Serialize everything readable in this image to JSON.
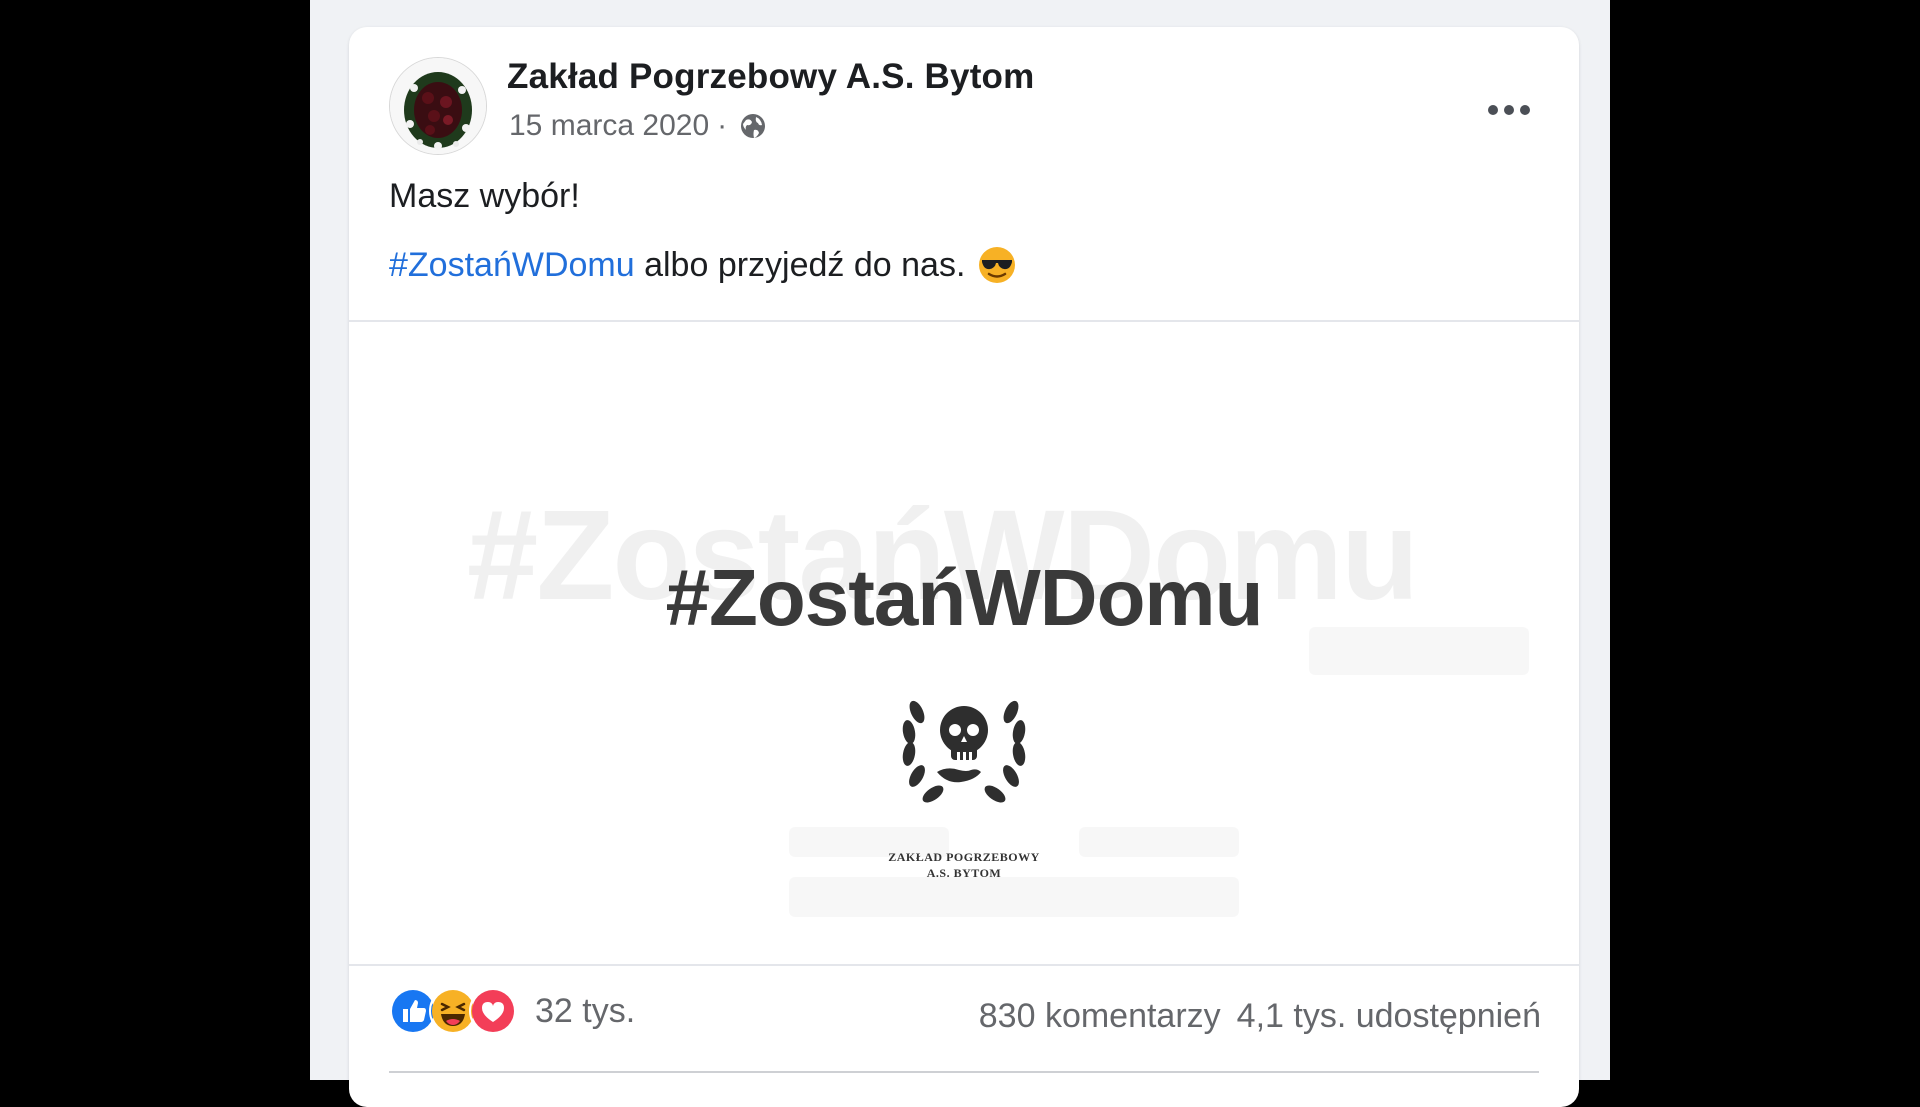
{
  "post": {
    "author": "Zakład Pogrzebowy A.S. Bytom",
    "date": "15 marca 2020",
    "separator": "·",
    "privacy_icon": "globe-icon",
    "more_icon": "more-options-icon",
    "text_line1": "Masz wybór!",
    "hashtag": "#ZostańWDomu",
    "text_line2_rest": " albo przyjedź do nas.",
    "emoji": "sunglasses-emoji"
  },
  "image": {
    "main_text": "#ZostańWDomu",
    "ghost_text": "#ZostańWDomu",
    "logo_line1": "ZAKŁAD POGRZEBOWY",
    "logo_line2": "A.S. BYTOM"
  },
  "footer": {
    "reactions": [
      "like-icon",
      "haha-icon",
      "love-icon"
    ],
    "reaction_count": "32 tys.",
    "comments": "830 komentarzy",
    "shares": "4,1 tys. udostępnień"
  },
  "colors": {
    "link": "#216fdb",
    "like": "#1877f2",
    "love": "#f33e58",
    "haha": "#f7b125",
    "text": "#1c1e21",
    "muted": "#65676b"
  }
}
